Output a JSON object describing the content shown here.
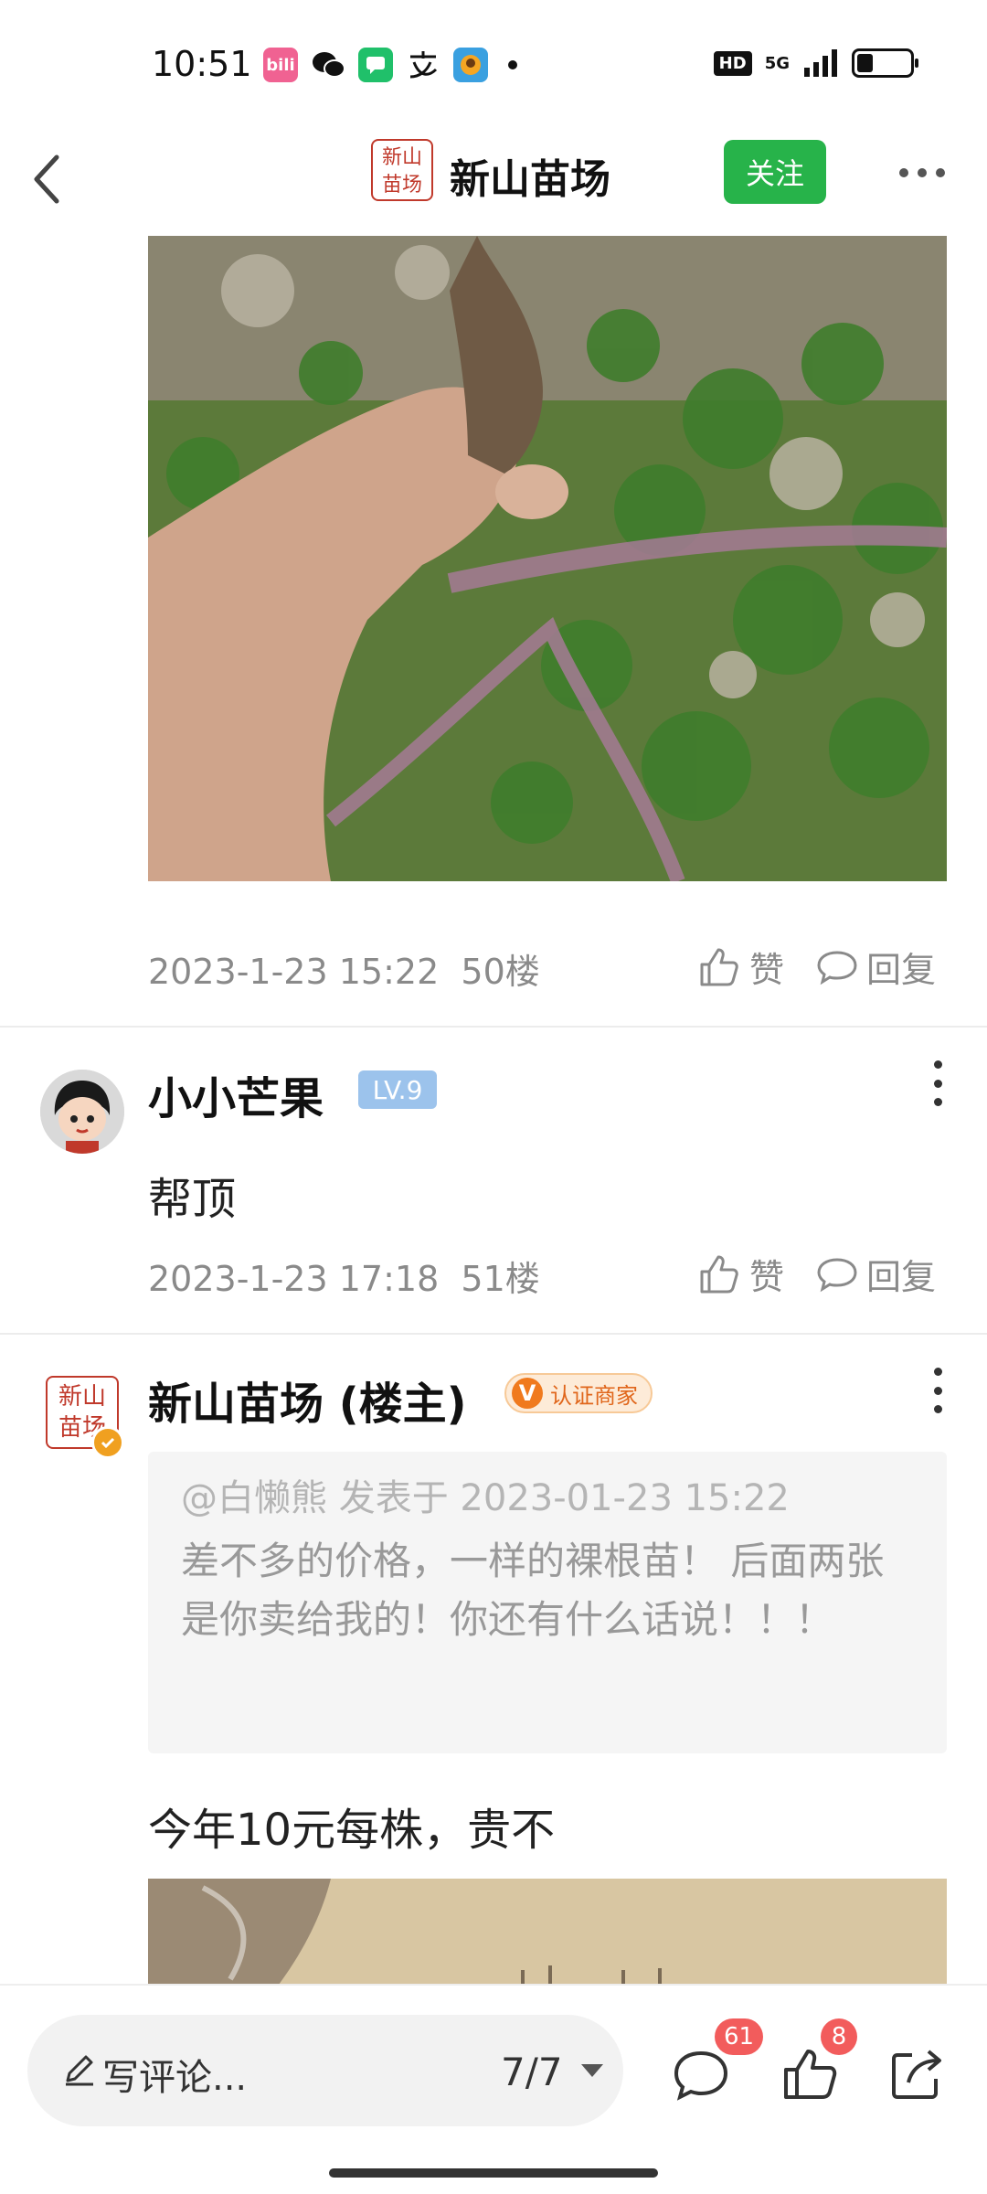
{
  "status_bar": {
    "time": "10:51",
    "apps": [
      {
        "icon": "bilibili-icon",
        "label": "bili",
        "color": "#f06292"
      },
      {
        "icon": "wechat-icon",
        "label": "",
        "color": "#111111"
      },
      {
        "icon": "messages-icon",
        "label": "",
        "color": "#20c06a"
      },
      {
        "icon": "alipay-icon",
        "label": "",
        "color": "#111111"
      },
      {
        "icon": "app-icon",
        "label": "",
        "color": "#3aa0e0"
      }
    ],
    "hd": "HD",
    "network": "5G",
    "battery_level": 0.3
  },
  "header": {
    "logo_text": "新山\n苗场",
    "title": "新山苗场",
    "follow_label": "关注"
  },
  "posts": [
    {
      "timestamp": "2023-1-23 15:22",
      "floor": "50楼",
      "like_label": "赞",
      "reply_label": "回复"
    },
    {
      "username": "小小芒果",
      "level": "LV.9",
      "text": "帮顶",
      "timestamp": "2023-1-23 17:18",
      "floor": "51楼",
      "like_label": "赞",
      "reply_label": "回复"
    },
    {
      "username": "新山苗场 (楼主)",
      "avatar_text": "新山\n苗场",
      "cert_label": "认证商家",
      "cert_v": "V",
      "quote_header": "@白懒熊 发表于 2023-01-23 15:22",
      "quote_body": "差不多的价格，一样的裸根苗！ 后面两张是你卖给我的！你还有什么话说！！！",
      "text": "今年10元每株，贵不"
    }
  ],
  "bottom_bar": {
    "comment_placeholder": "写评论...",
    "page_indicator": "7/7",
    "comment_count": "61",
    "like_count": "8"
  },
  "colors": {
    "accent_green": "#27b34a",
    "badge_red": "#f25c5c",
    "level_blue": "#9cc3ec",
    "cert_orange": "#f07a1e"
  }
}
